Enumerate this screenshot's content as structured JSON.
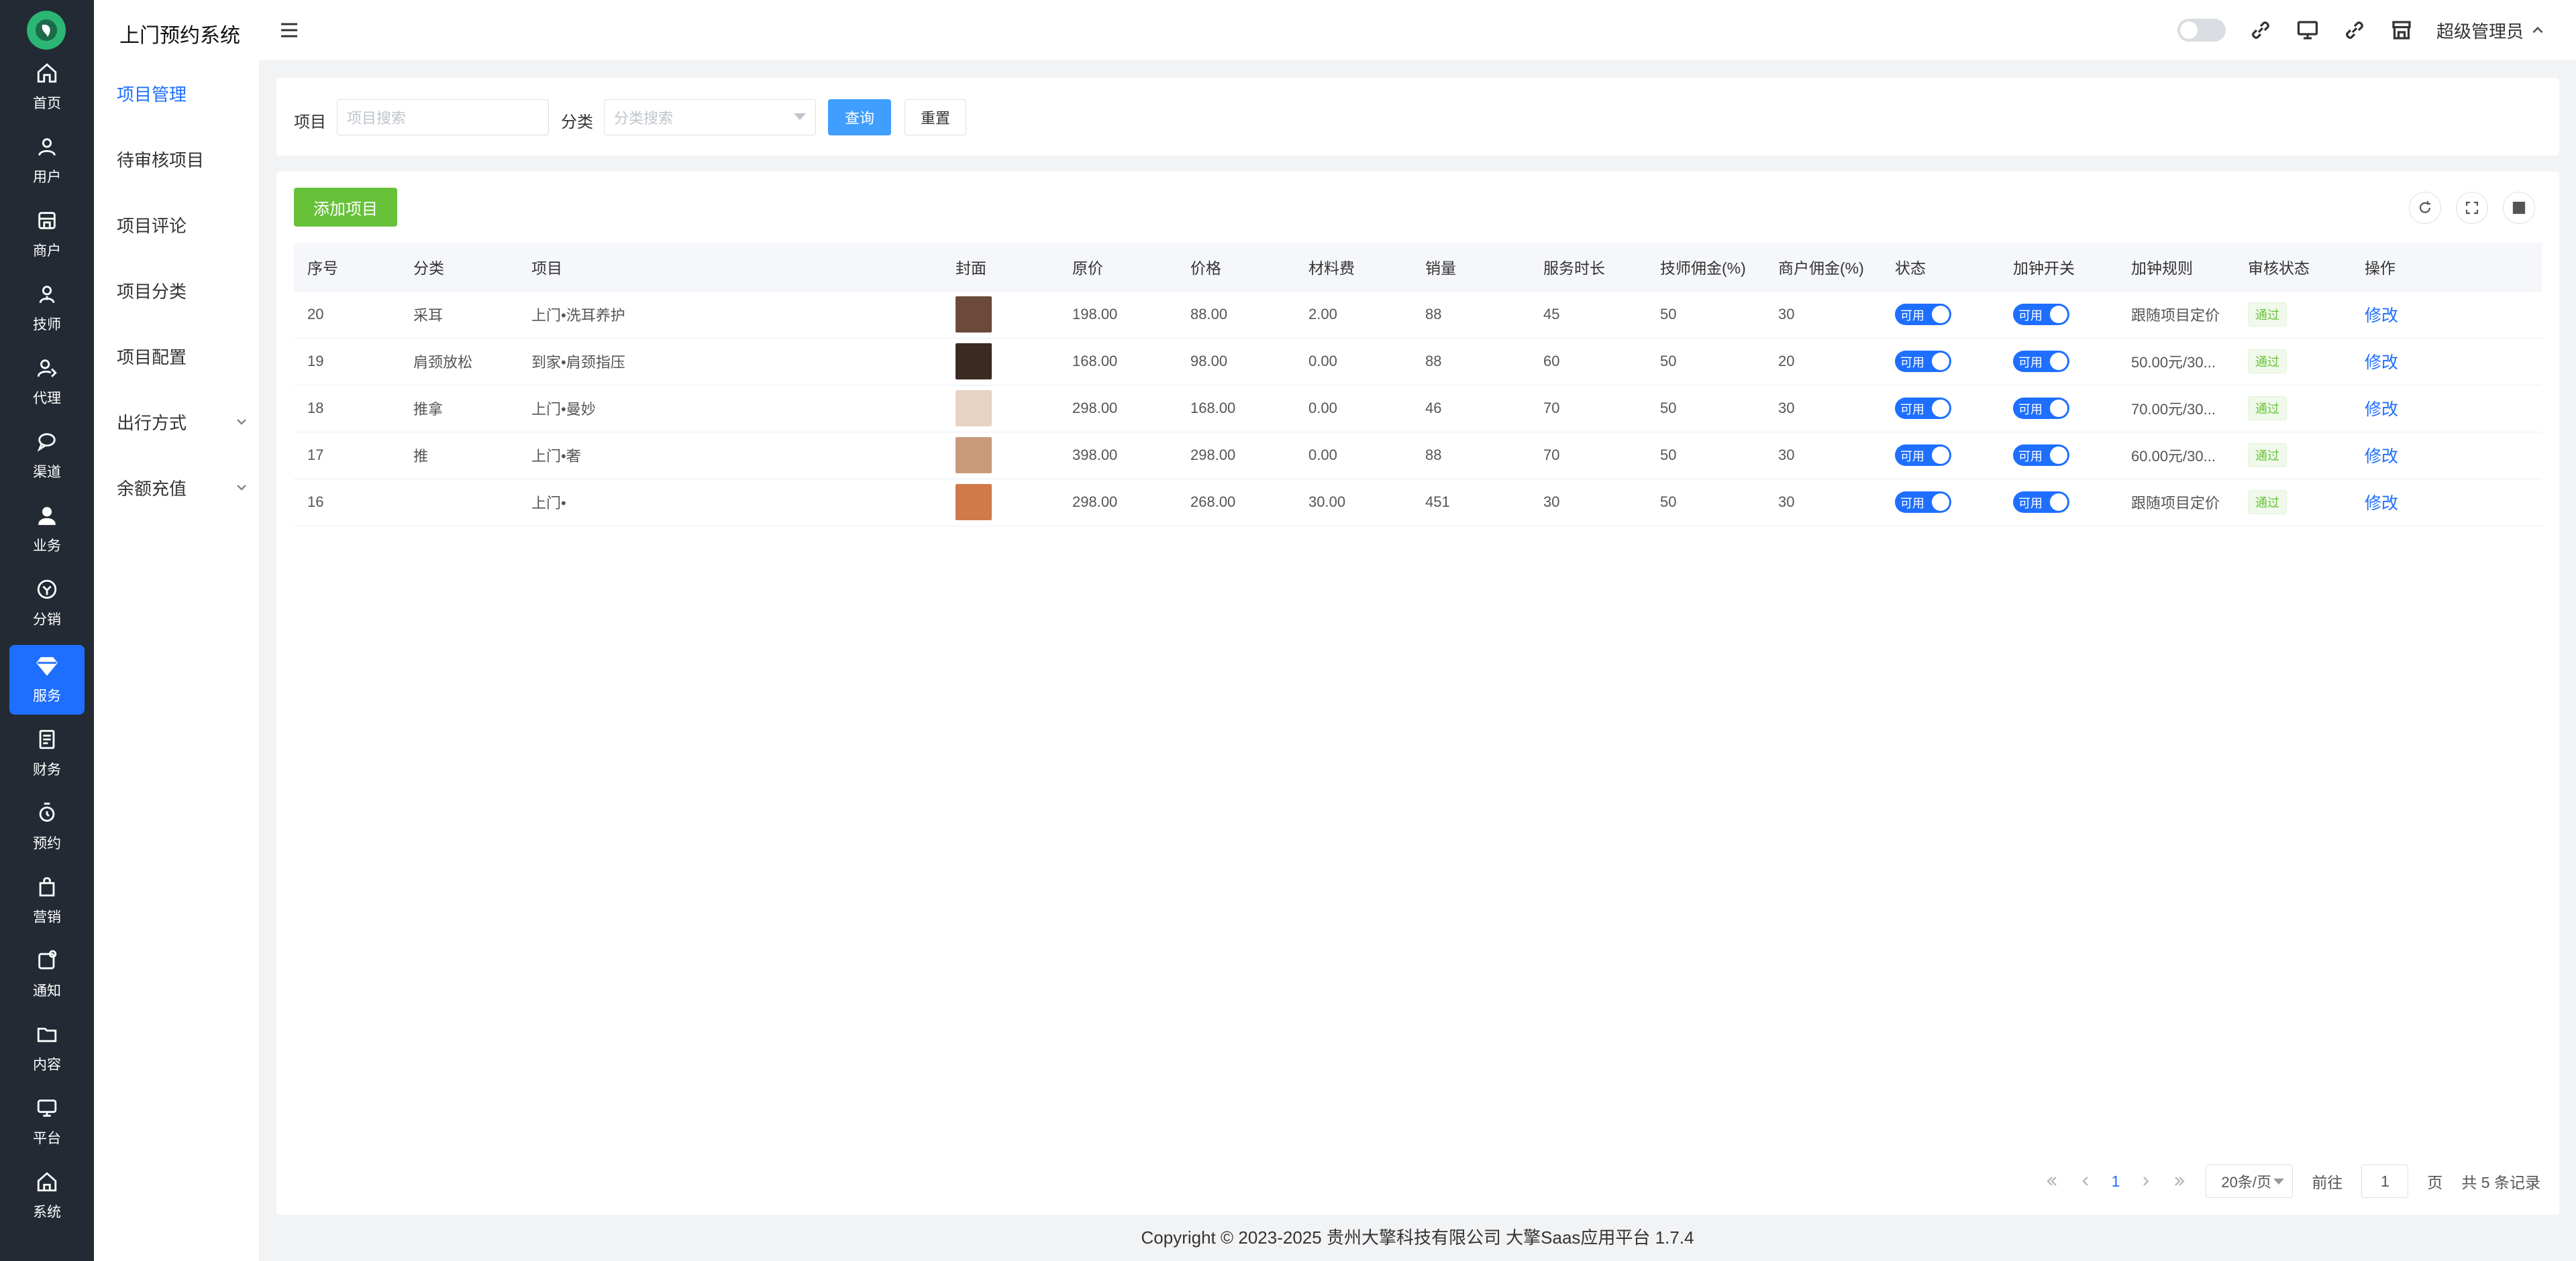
{
  "app": {
    "title": "上门预约系统"
  },
  "rail": [
    {
      "label": "首页",
      "icon": "home-icon"
    },
    {
      "label": "用户",
      "icon": "user-icon"
    },
    {
      "label": "商户",
      "icon": "shop-icon"
    },
    {
      "label": "技师",
      "icon": "technician-icon"
    },
    {
      "label": "代理",
      "icon": "agent-icon"
    },
    {
      "label": "渠道",
      "icon": "channel-icon"
    },
    {
      "label": "业务",
      "icon": "business-icon"
    },
    {
      "label": "分销",
      "icon": "distribution-icon"
    },
    {
      "label": "服务",
      "icon": "service-icon"
    },
    {
      "label": "财务",
      "icon": "finance-icon"
    },
    {
      "label": "预约",
      "icon": "booking-icon"
    },
    {
      "label": "营销",
      "icon": "marketing-icon"
    },
    {
      "label": "通知",
      "icon": "notice-icon"
    },
    {
      "label": "内容",
      "icon": "content-icon"
    },
    {
      "label": "平台",
      "icon": "platform-icon"
    },
    {
      "label": "系统",
      "icon": "system-icon"
    }
  ],
  "submenu": [
    {
      "label": "项目管理"
    },
    {
      "label": "待审核项目"
    },
    {
      "label": "项目评论"
    },
    {
      "label": "项目分类"
    },
    {
      "label": "项目配置"
    },
    {
      "label": "出行方式"
    },
    {
      "label": "余额充值"
    }
  ],
  "topbar": {
    "user": "超级管理员"
  },
  "search": {
    "item_label": "项目",
    "item_placeholder": "项目搜索",
    "cat_label": "分类",
    "cat_placeholder": "分类搜索",
    "query": "查询",
    "reset": "重置"
  },
  "main": {
    "add_button": "添加项目"
  },
  "table": {
    "headers": [
      "序号",
      "分类",
      "项目",
      "封面",
      "原价",
      "价格",
      "材料费",
      "销量",
      "服务时长",
      "技师佣金(%)",
      "商户佣金(%)",
      "状态",
      "加钟开关",
      "加钟规则",
      "审核状态",
      "操作"
    ],
    "rows": [
      {
        "id": "20",
        "category": "采耳",
        "name": "上门•洗耳养护",
        "cover_color": "#6b4a3a",
        "orig": "198.00",
        "price": "88.00",
        "material": "2.00",
        "sales": "88",
        "duration": "45",
        "tech": "50",
        "merchant": "30",
        "status": "可用",
        "overtime": "可用",
        "rule": "跟随项目定价",
        "audit": "通过",
        "action": "修改"
      },
      {
        "id": "19",
        "category": "肩颈放松",
        "name": "到家•肩颈指压",
        "cover_color": "#3a2a22",
        "orig": "168.00",
        "price": "98.00",
        "material": "0.00",
        "sales": "88",
        "duration": "60",
        "tech": "50",
        "merchant": "20",
        "status": "可用",
        "overtime": "可用",
        "rule": "50.00元/30...",
        "audit": "通过",
        "action": "修改"
      },
      {
        "id": "18",
        "category": "推拿",
        "name": "上门•曼妙",
        "cover_color": "#e8d2c4",
        "orig": "298.00",
        "price": "168.00",
        "material": "0.00",
        "sales": "46",
        "duration": "70",
        "tech": "50",
        "merchant": "30",
        "status": "可用",
        "overtime": "可用",
        "rule": "70.00元/30...",
        "audit": "通过",
        "action": "修改"
      },
      {
        "id": "17",
        "category": "推",
        "name": "上门•奢",
        "cover_color": "#c89a7a",
        "orig": "398.00",
        "price": "298.00",
        "material": "0.00",
        "sales": "88",
        "duration": "70",
        "tech": "50",
        "merchant": "30",
        "status": "可用",
        "overtime": "可用",
        "rule": "60.00元/30...",
        "audit": "通过",
        "action": "修改"
      },
      {
        "id": "16",
        "category": "",
        "name": "上门•",
        "cover_color": "#d07a4a",
        "orig": "298.00",
        "price": "268.00",
        "material": "30.00",
        "sales": "451",
        "duration": "30",
        "tech": "50",
        "merchant": "30",
        "status": "可用",
        "overtime": "可用",
        "rule": "跟随项目定价",
        "audit": "通过",
        "action": "修改"
      }
    ]
  },
  "pager": {
    "current": "1",
    "size": "20条/页",
    "goto_prefix": "前往",
    "goto_value": "1",
    "goto_suffix": "页",
    "total": "共 5 条记录"
  },
  "footer": {
    "text": "Copyright © 2023-2025 贵州大擎科技有限公司  大擎Saas应用平台 1.7.4"
  },
  "colors": {
    "primary": "#1e6fff",
    "success": "#67c23a",
    "rail_bg": "#232a33"
  }
}
